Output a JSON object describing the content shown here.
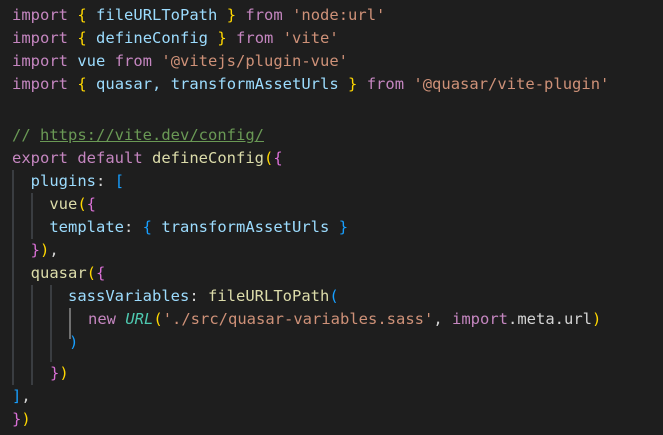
{
  "code": {
    "l1": {
      "kw": "import",
      "b1": "{",
      "id": "fileURLToPath",
      "b2": "}",
      "from": "from",
      "str": "'node:url'"
    },
    "l2": {
      "kw": "import",
      "b1": "{",
      "id": "defineConfig",
      "b2": "}",
      "from": "from",
      "str": "'vite'"
    },
    "l3": {
      "kw": "import",
      "id": "vue",
      "from": "from",
      "str": "'@vitejs/plugin-vue'"
    },
    "l4": {
      "kw": "import",
      "b1": "{",
      "id1": "quasar,",
      "id2": "transformAssetUrls",
      "b2": "}",
      "from": "from",
      "str": "'@quasar/vite-plugin'"
    },
    "l6": {
      "slashes": "//",
      "url": "https://vite.dev/config/"
    },
    "l7": {
      "export": "export",
      "default": "default",
      "fn": "defineConfig",
      "p": "(",
      "b": "{"
    },
    "l8": {
      "key": "plugins",
      "colon": ":",
      "b": "["
    },
    "l9": {
      "fn": "vue",
      "p": "(",
      "b": "{"
    },
    "l10": {
      "key": "template",
      "colon": ":",
      "b1": "{",
      "id": "transformAssetUrls",
      "b2": "}"
    },
    "l11": {
      "b": "}",
      "p": ")",
      "comma": ","
    },
    "l12": {
      "fn": "quasar",
      "p": "(",
      "b": "{"
    },
    "l13": {
      "key": "sassVariables",
      "colon": ":",
      "fn": "fileURLToPath",
      "p": "("
    },
    "l14": {
      "new": "new",
      "cls": "URL",
      "p1": "(",
      "str": "'./src/quasar-variables.sass'",
      "comma": ",",
      "imp": "import",
      "meta": ".meta.url",
      "p2": ")"
    },
    "l15": {
      "p": ")"
    },
    "l16": {
      "b": "}",
      "p": ")"
    },
    "l17": {
      "b": "]",
      "comma": ","
    },
    "l18": {
      "b": "}",
      "p": ")"
    }
  }
}
